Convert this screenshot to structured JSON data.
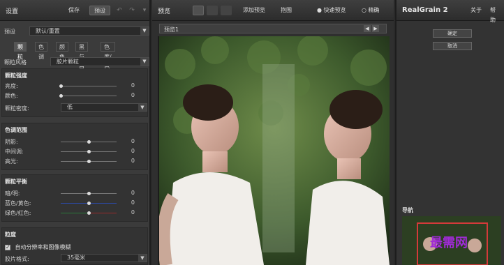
{
  "left_panel": {
    "title": "设置",
    "save_label": "保存",
    "preset_button": "预设",
    "preset_label": "预设",
    "preset_value": "默认/重置",
    "tabs": [
      "颗粒",
      "色调",
      "颜色",
      "黑与白",
      "色度/色调"
    ],
    "grain_style_label": "颗粒风格",
    "grain_style_value": "胶片颗粒",
    "grain_strength": {
      "header": "颗粒强度",
      "rows": [
        {
          "label": "亮度:",
          "value": "0",
          "level": 0
        },
        {
          "label": "颜色:",
          "value": "0",
          "level": 0
        }
      ],
      "density_label": "颗粒密度:",
      "density_value": "低"
    },
    "tone_range": {
      "header": "色调范围",
      "rows": [
        {
          "label": "阴影:",
          "value": "0",
          "level": 0.5
        },
        {
          "label": "中间调:",
          "value": "0",
          "level": 0.5
        },
        {
          "label": "高光:",
          "value": "0",
          "level": 0.5
        }
      ]
    },
    "grain_balance": {
      "header": "颗粒平衡",
      "rows": [
        {
          "label": "暗/明:",
          "value": "0",
          "level": 0.5
        },
        {
          "label": "蓝色/黄色:",
          "value": "0",
          "level": 0.5
        },
        {
          "label": "绿色/红色:",
          "value": "0",
          "level": 0.5
        }
      ]
    },
    "roughness": {
      "header": "粒度",
      "checkbox_label": "自动分辨率和图像模糊",
      "film_format_label": "胶片格式:",
      "film_format_value": "35毫米"
    }
  },
  "center_panel": {
    "title": "预览",
    "add_preview": "添加预览",
    "overlay": "抱围",
    "fast_preview": "快速预览",
    "accurate": "精确",
    "preview_tab": "预览1",
    "photo_text": "最需网"
  },
  "right_panel": {
    "brand": "RealGrain 2",
    "about": "关于",
    "help": "帮助",
    "ok": "确定",
    "cancel": "取消",
    "navigator": "导航",
    "watermark": "最需网"
  },
  "colors": {
    "accent_knob": "#dddddd",
    "blue_track": "#2c4aa8",
    "green_track": "#2a7a3a",
    "red_track": "#9a2a2a",
    "watermark": "#a02bd6"
  }
}
